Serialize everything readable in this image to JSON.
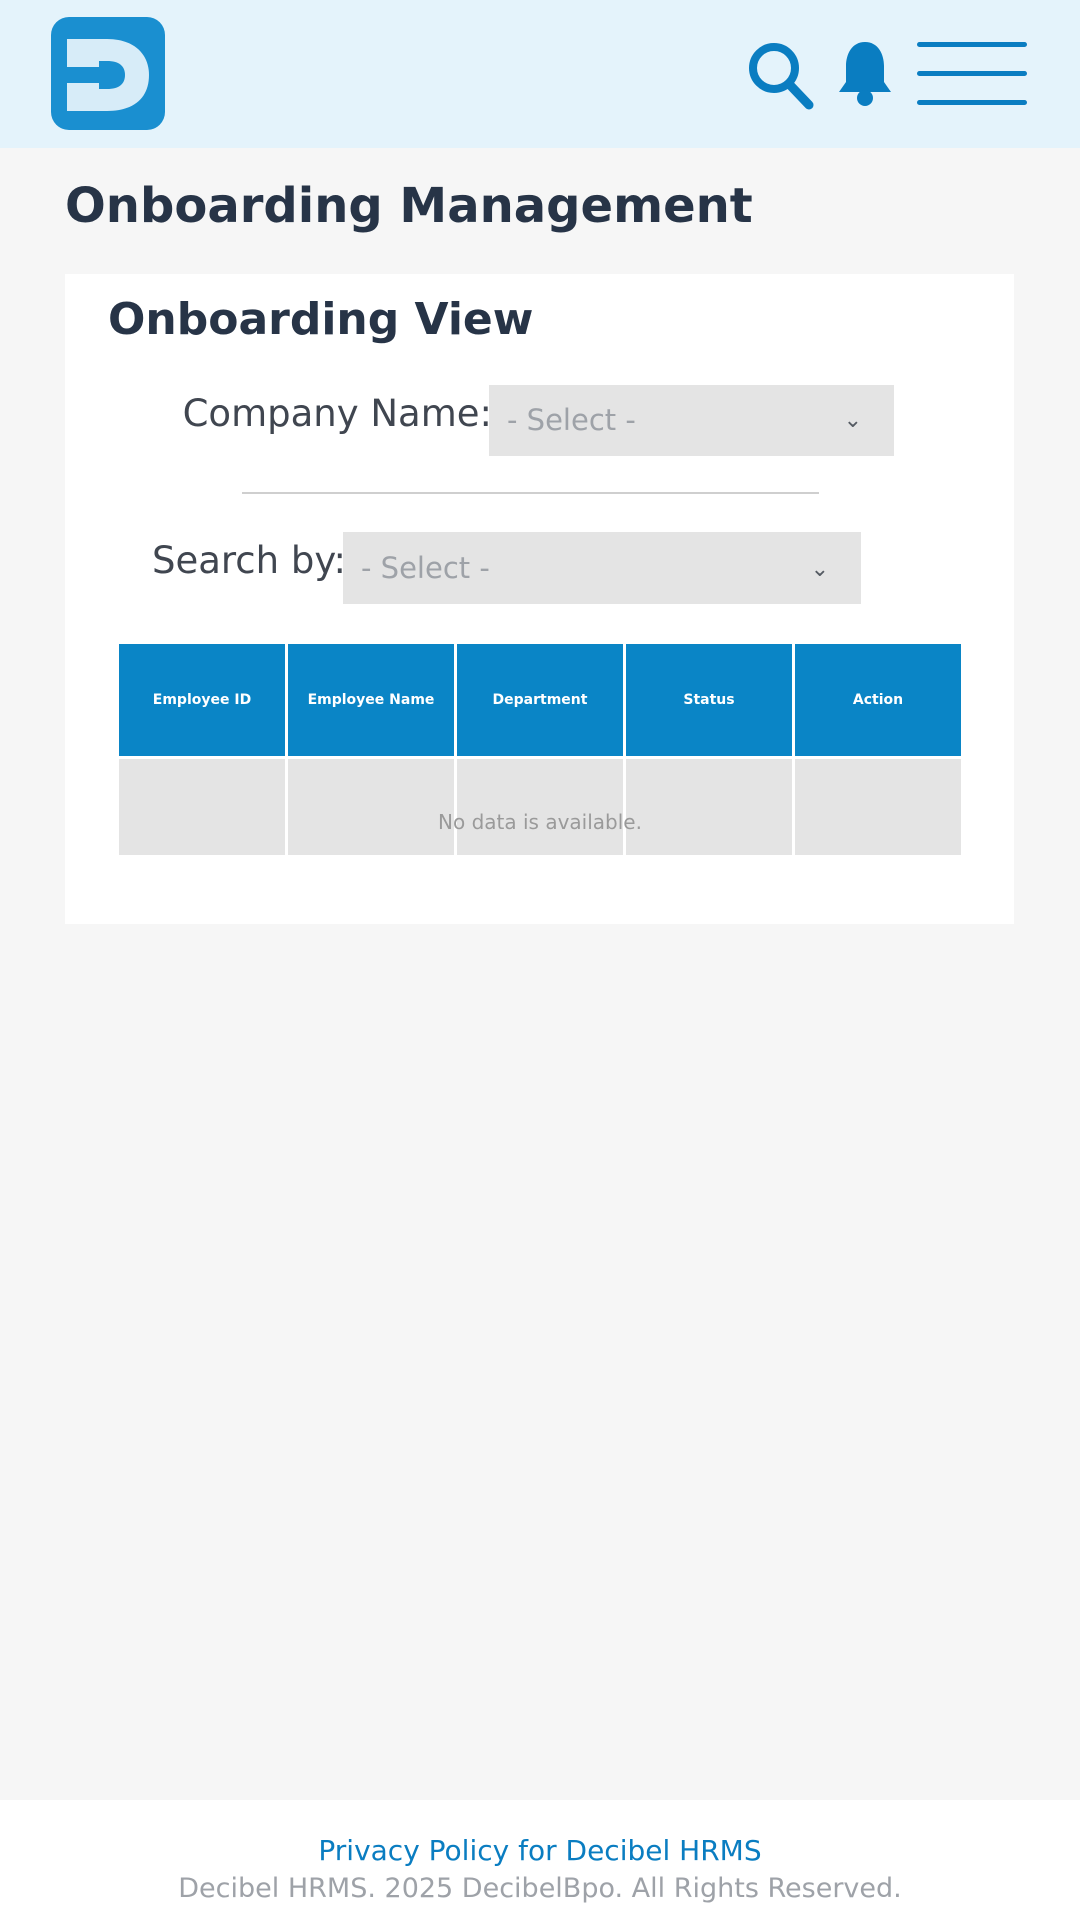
{
  "brand": {
    "logo_letter": "D",
    "primary_color": "#0a85c6",
    "header_bg": "#e4f3fb"
  },
  "header": {
    "icons": [
      "search-icon",
      "bell-icon",
      "menu-icon"
    ]
  },
  "page": {
    "title": "Onboarding Management"
  },
  "card": {
    "title": "Onboarding View",
    "company_field": {
      "label": "Company Name:",
      "value": "- Select -"
    },
    "search_field": {
      "label": "Search by:",
      "value": "- Select -"
    },
    "table": {
      "columns": [
        "Employee ID",
        "Employee Name",
        "Department",
        "Status",
        "Action"
      ],
      "empty_message": "No data is available."
    }
  },
  "footer": {
    "privacy_link": "Privacy Policy for Decibel HRMS",
    "copyright": "Decibel HRMS. 2025 DecibelBpo. All Rights Reserved."
  }
}
